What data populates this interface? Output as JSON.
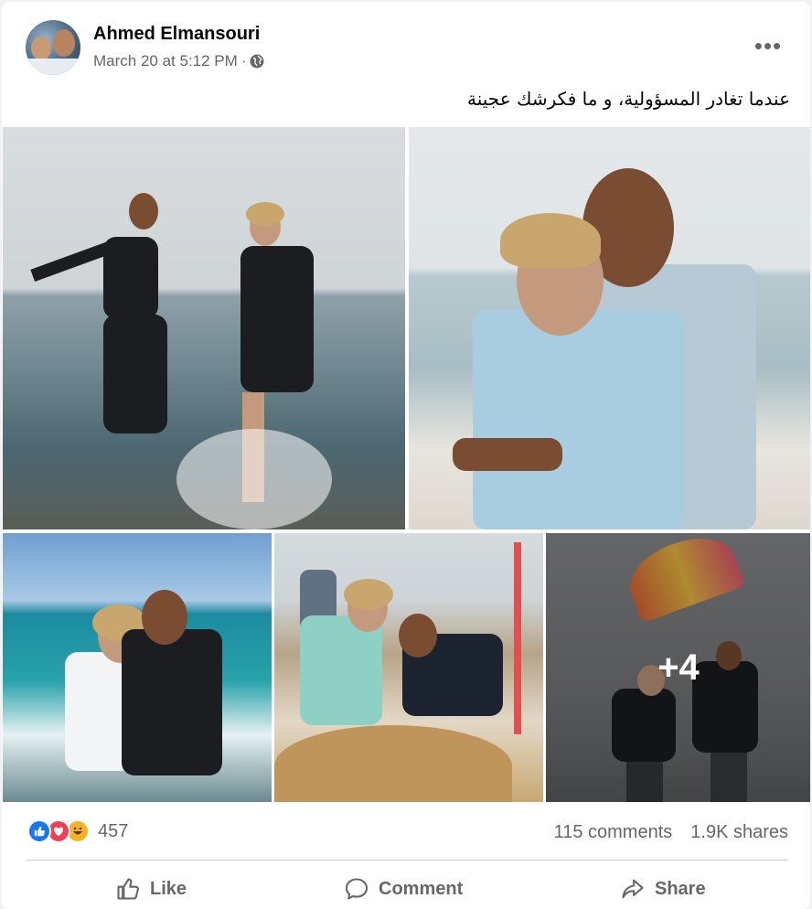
{
  "post": {
    "author": "Ahmed Elmansouri",
    "timestamp": "March 20 at 5:12 PM",
    "separator": "·",
    "audience_icon": "globe-icon",
    "menu_icon": "more-horizontal-icon",
    "text": "عندما تغادر المسؤولية، و ما فكرشك عجينة"
  },
  "photos": {
    "count_shown": 5,
    "more_overlay": "+4"
  },
  "reactions": {
    "types": [
      "like",
      "love",
      "haha"
    ],
    "count": "457",
    "comments": "115 comments",
    "shares": "1.9K shares"
  },
  "actions": {
    "like": "Like",
    "comment": "Comment",
    "share": "Share"
  },
  "colors": {
    "like_blue": "#1877f2",
    "love_red": "#f33e58",
    "haha_yellow": "#f7b125",
    "secondary_text": "#65676b"
  }
}
